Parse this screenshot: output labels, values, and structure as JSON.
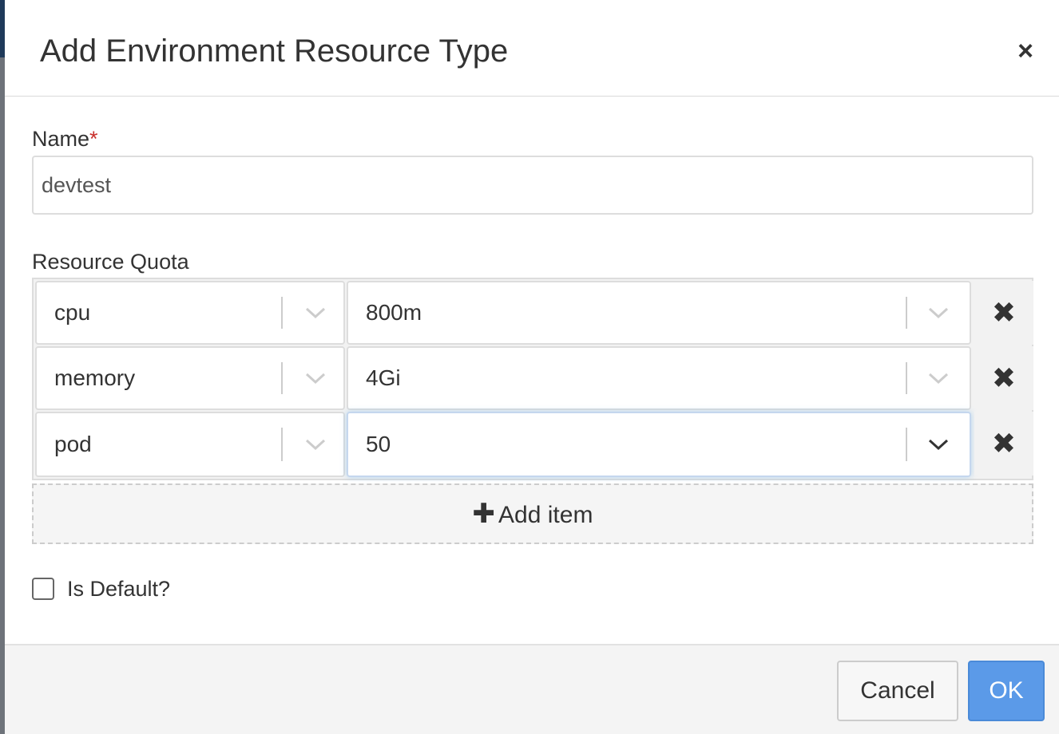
{
  "dialog": {
    "title": "Add Environment Resource Type",
    "close_glyph": "×"
  },
  "form": {
    "name_label": "Name",
    "required_marker": "*",
    "name_value": "devtest",
    "quota_label": "Resource Quota",
    "quota_rows": [
      {
        "resource": "cpu",
        "value": "800m",
        "remove_glyph": "✖"
      },
      {
        "resource": "memory",
        "value": "4Gi",
        "remove_glyph": "✖"
      },
      {
        "resource": "pod",
        "value": "50",
        "remove_glyph": "✖"
      }
    ],
    "add_item_glyph": "✚",
    "add_item_label": "Add item",
    "default_label": "Is Default?",
    "default_checked": false
  },
  "footer": {
    "cancel_label": "Cancel",
    "ok_label": "OK"
  },
  "icons": {
    "close": "close-icon",
    "chevron": "chevron-down-icon",
    "remove": "remove-icon",
    "add": "plus-icon"
  },
  "colors": {
    "required": "#c9302c",
    "primary": "#5b9ae8",
    "backdrop": "#5a5f66"
  }
}
